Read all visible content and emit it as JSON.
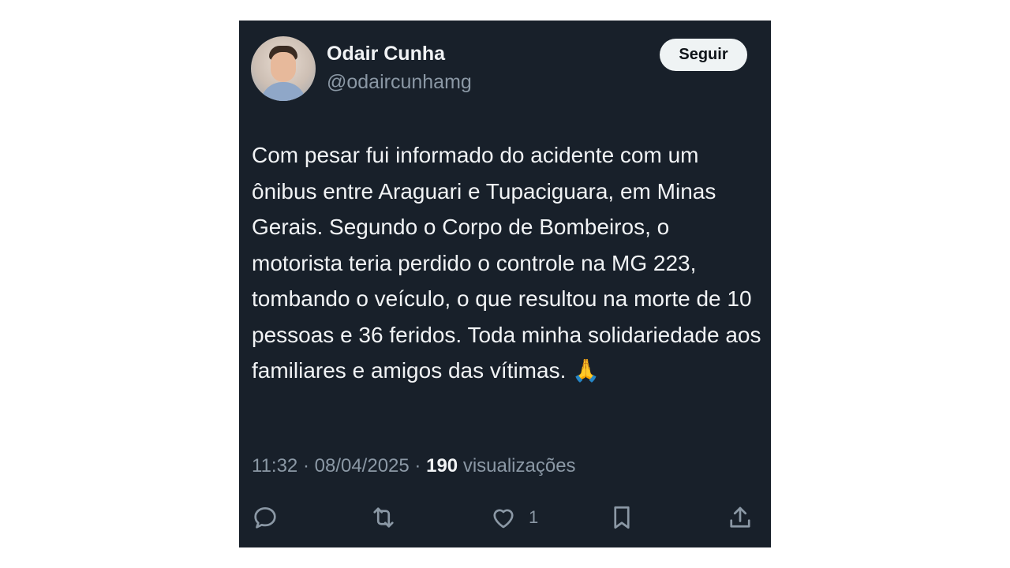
{
  "user": {
    "name": "Odair Cunha",
    "handle": "@odaircunhamg",
    "follow_label": "Seguir"
  },
  "tweet": {
    "text": "Com pesar fui informado do acidente com um ônibus entre Araguari e Tupaciguara, em Minas Gerais. Segundo o Corpo de Bombeiros, o motorista teria perdido o controle na MG 223, tombando o veículo, o que resultou na morte de 10 pessoas e 36 feridos. Toda minha solidariedade aos familiares e amigos das vítimas. 🙏",
    "time": "11:32",
    "date": "08/04/2025",
    "views": "190",
    "views_label": "visualizações",
    "separator": "·"
  },
  "actions": {
    "reply_icon": "reply-icon",
    "retweet_icon": "retweet-icon",
    "like_icon": "heart-icon",
    "like_count": "1",
    "bookmark_icon": "bookmark-icon",
    "share_icon": "share-icon"
  },
  "colors": {
    "card_bg": "#18202a",
    "text": "#f1f3f5",
    "muted": "#8b98a5",
    "follow_bg": "#eff3f4"
  }
}
